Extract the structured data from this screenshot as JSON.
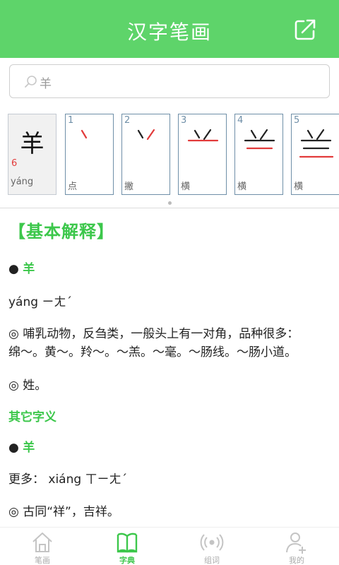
{
  "header": {
    "title": "汉字笔画",
    "share_icon": "share-icon"
  },
  "search": {
    "value": "羊",
    "placeholder": "羊"
  },
  "character": {
    "glyph": "羊",
    "stroke_count": "6",
    "pinyin": "yáng"
  },
  "strokes": [
    {
      "num": "1",
      "name": "点"
    },
    {
      "num": "2",
      "name": "撇"
    },
    {
      "num": "3",
      "name": "横"
    },
    {
      "num": "4",
      "name": "横"
    },
    {
      "num": "5",
      "name": "横"
    }
  ],
  "content": {
    "section_title": "【基本解释】",
    "bullet1_char": "羊",
    "pinyin_line": "yáng ㄧㄤˊ",
    "def1_line1": "◎ 哺乳动物，反刍类，一般头上有一对角，品种很多：",
    "def1_line2": "绵～。黄～。羚～。～羔。～毫。～肠线。～肠小道。",
    "def2": "◎ 姓。",
    "other_title": "其它字义",
    "bullet2_char": "羊",
    "more_line": "更多： xiáng ㄒㄧㄤˊ",
    "def3": "◎ 古同“祥”，吉祥。"
  },
  "tabs": [
    {
      "label": "笔画",
      "icon": "home-icon"
    },
    {
      "label": "字典",
      "icon": "book-icon"
    },
    {
      "label": "组词",
      "icon": "broadcast-icon"
    },
    {
      "label": "我的",
      "icon": "user-add-icon"
    }
  ],
  "colors": {
    "brand": "#5ed46a",
    "accent": "#3cc74b",
    "stroke_red": "#e23b3b",
    "card_border": "#6f8fa8"
  }
}
